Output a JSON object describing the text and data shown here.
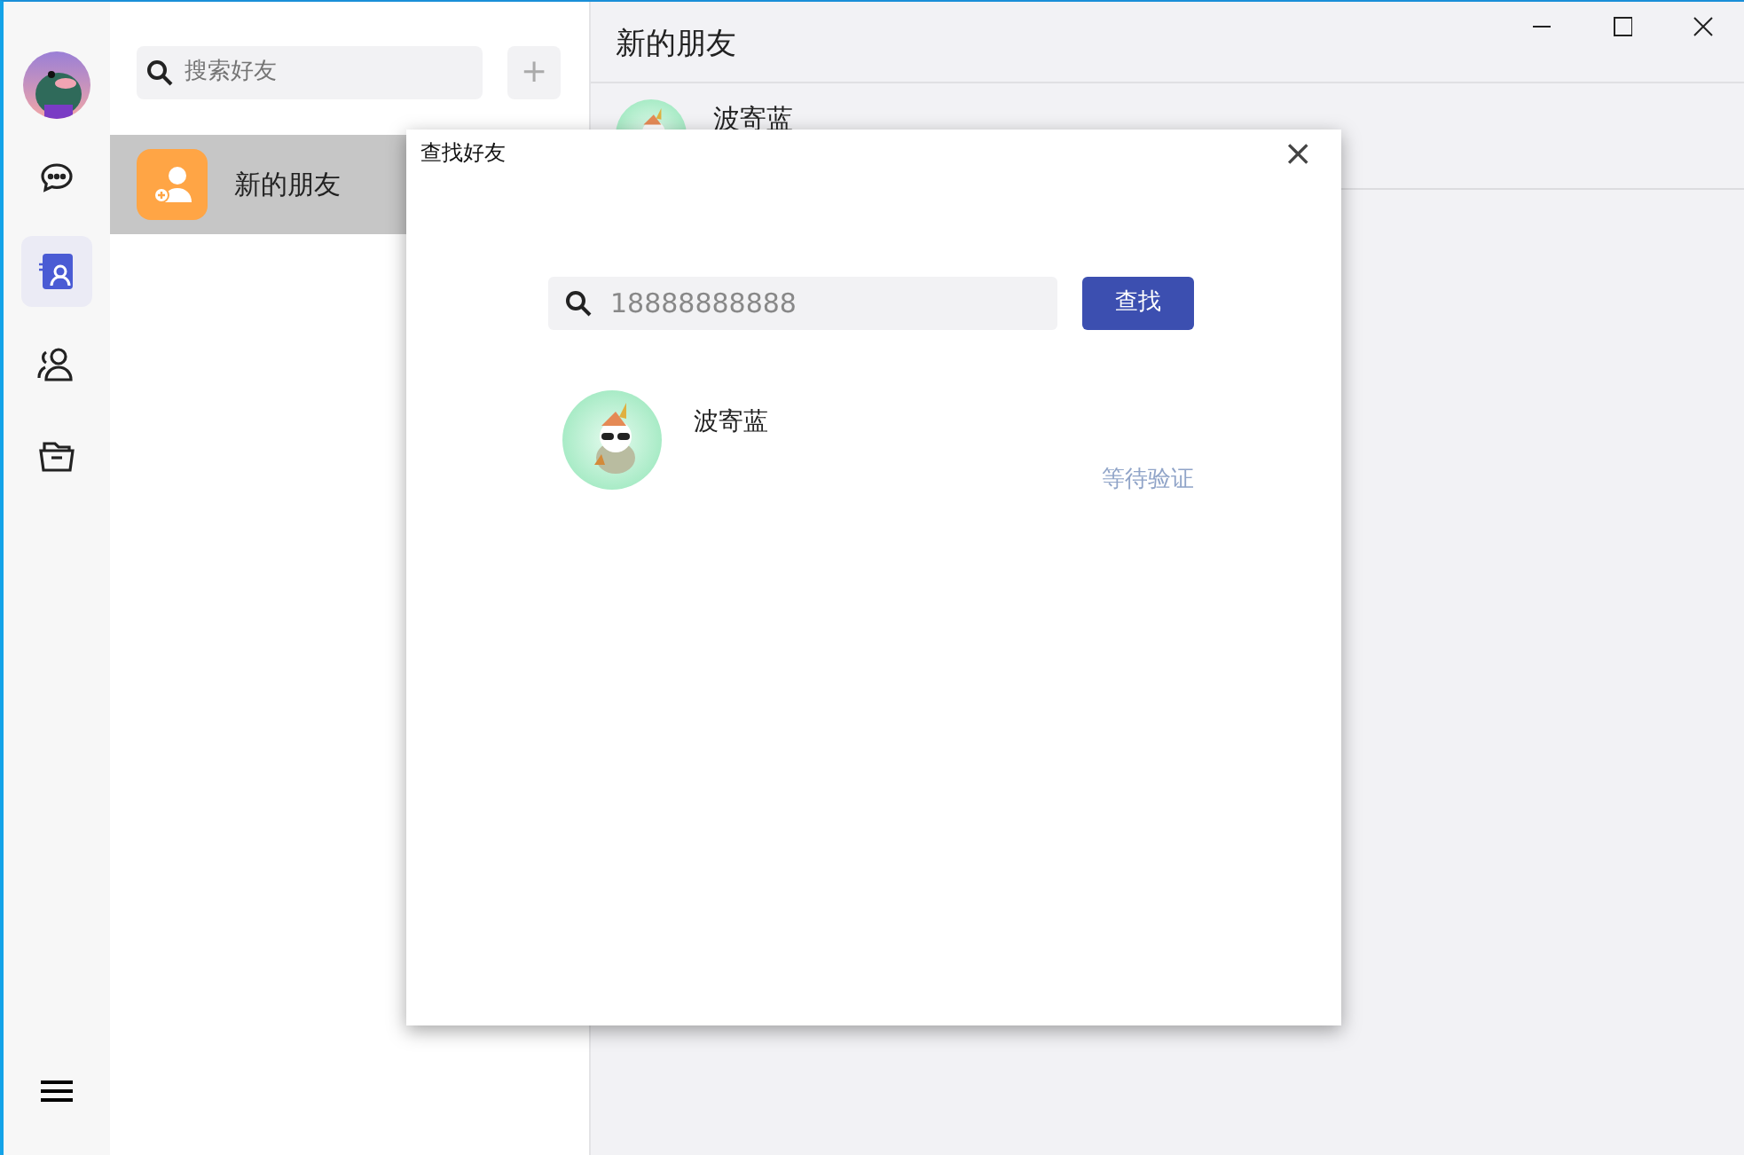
{
  "nav": [
    {
      "kind": "chat",
      "selected": false
    },
    {
      "kind": "contacts",
      "selected": true
    },
    {
      "kind": "groups",
      "selected": false
    },
    {
      "kind": "files",
      "selected": false
    }
  ],
  "contacts_panel": {
    "search": {
      "placeholder": "搜索好友"
    },
    "add_button": "+",
    "items": [
      {
        "label": "新的朋友",
        "selected": true
      }
    ]
  },
  "main": {
    "title": "新的朋友",
    "requests": [
      {
        "name": "波寄蓝"
      }
    ]
  },
  "dialog": {
    "title": "查找好友",
    "close": "×",
    "search": {
      "value": "18888888888"
    },
    "search_button": "查找",
    "results": [
      {
        "name": "波寄蓝",
        "status": "等待验证"
      }
    ]
  }
}
